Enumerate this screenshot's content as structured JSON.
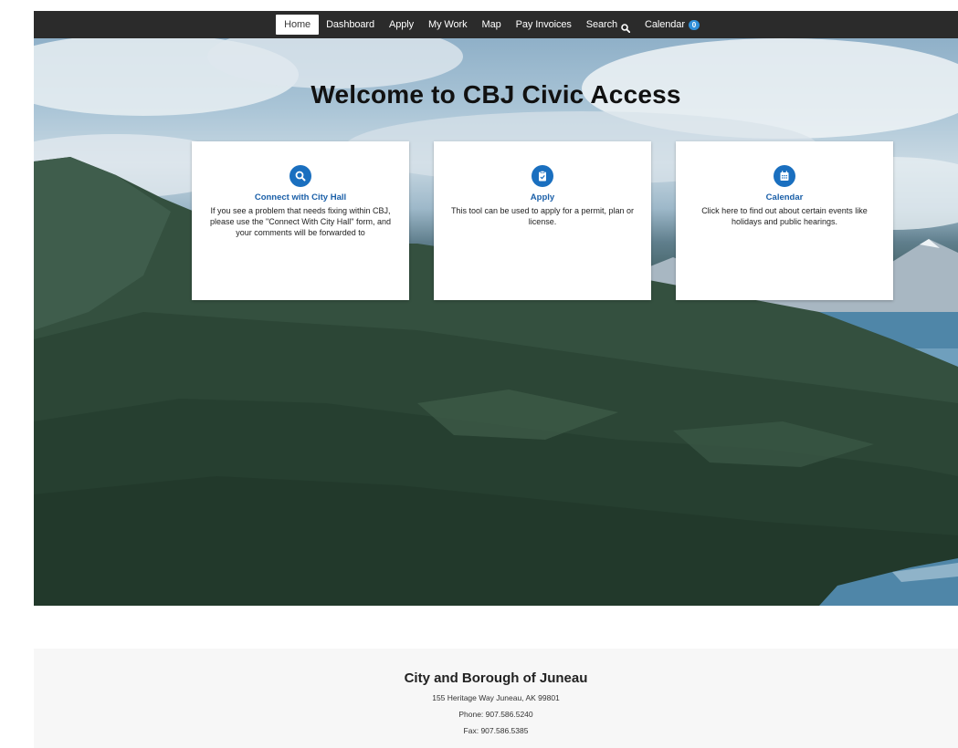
{
  "nav": {
    "items": [
      {
        "label": "Home",
        "active": true
      },
      {
        "label": "Dashboard"
      },
      {
        "label": "Apply"
      },
      {
        "label": "My Work"
      },
      {
        "label": "Map"
      },
      {
        "label": "Pay Invoices"
      },
      {
        "label": "Search",
        "icon": "search-icon"
      },
      {
        "label": "Calendar",
        "badge": "0"
      }
    ]
  },
  "hero": {
    "title": "Welcome to CBJ Civic Access",
    "cards": [
      {
        "title": "Connect with City Hall",
        "icon": "search-icon",
        "description": "If you see a problem that needs fixing within CBJ, please use the \"Connect With City Hall\" form, and your comments will be forwarded to"
      },
      {
        "title": "Apply",
        "icon": "clipboard-check-icon",
        "description": "This tool can be used to apply for a permit, plan or license."
      },
      {
        "title": "Calendar",
        "icon": "calendar-icon",
        "description": "Click here to find out about certain events like holidays and public hearings."
      }
    ]
  },
  "footer": {
    "title": "City and Borough of Juneau",
    "address": "155 Heritage Way Juneau, AK 99801",
    "phone": "Phone: 907.586.5240",
    "fax": "Fax: 907.586.5385"
  },
  "colors": {
    "nav_bg": "#2b2b2b",
    "accent": "#1a6fbf",
    "badge": "#2f8fd8"
  }
}
